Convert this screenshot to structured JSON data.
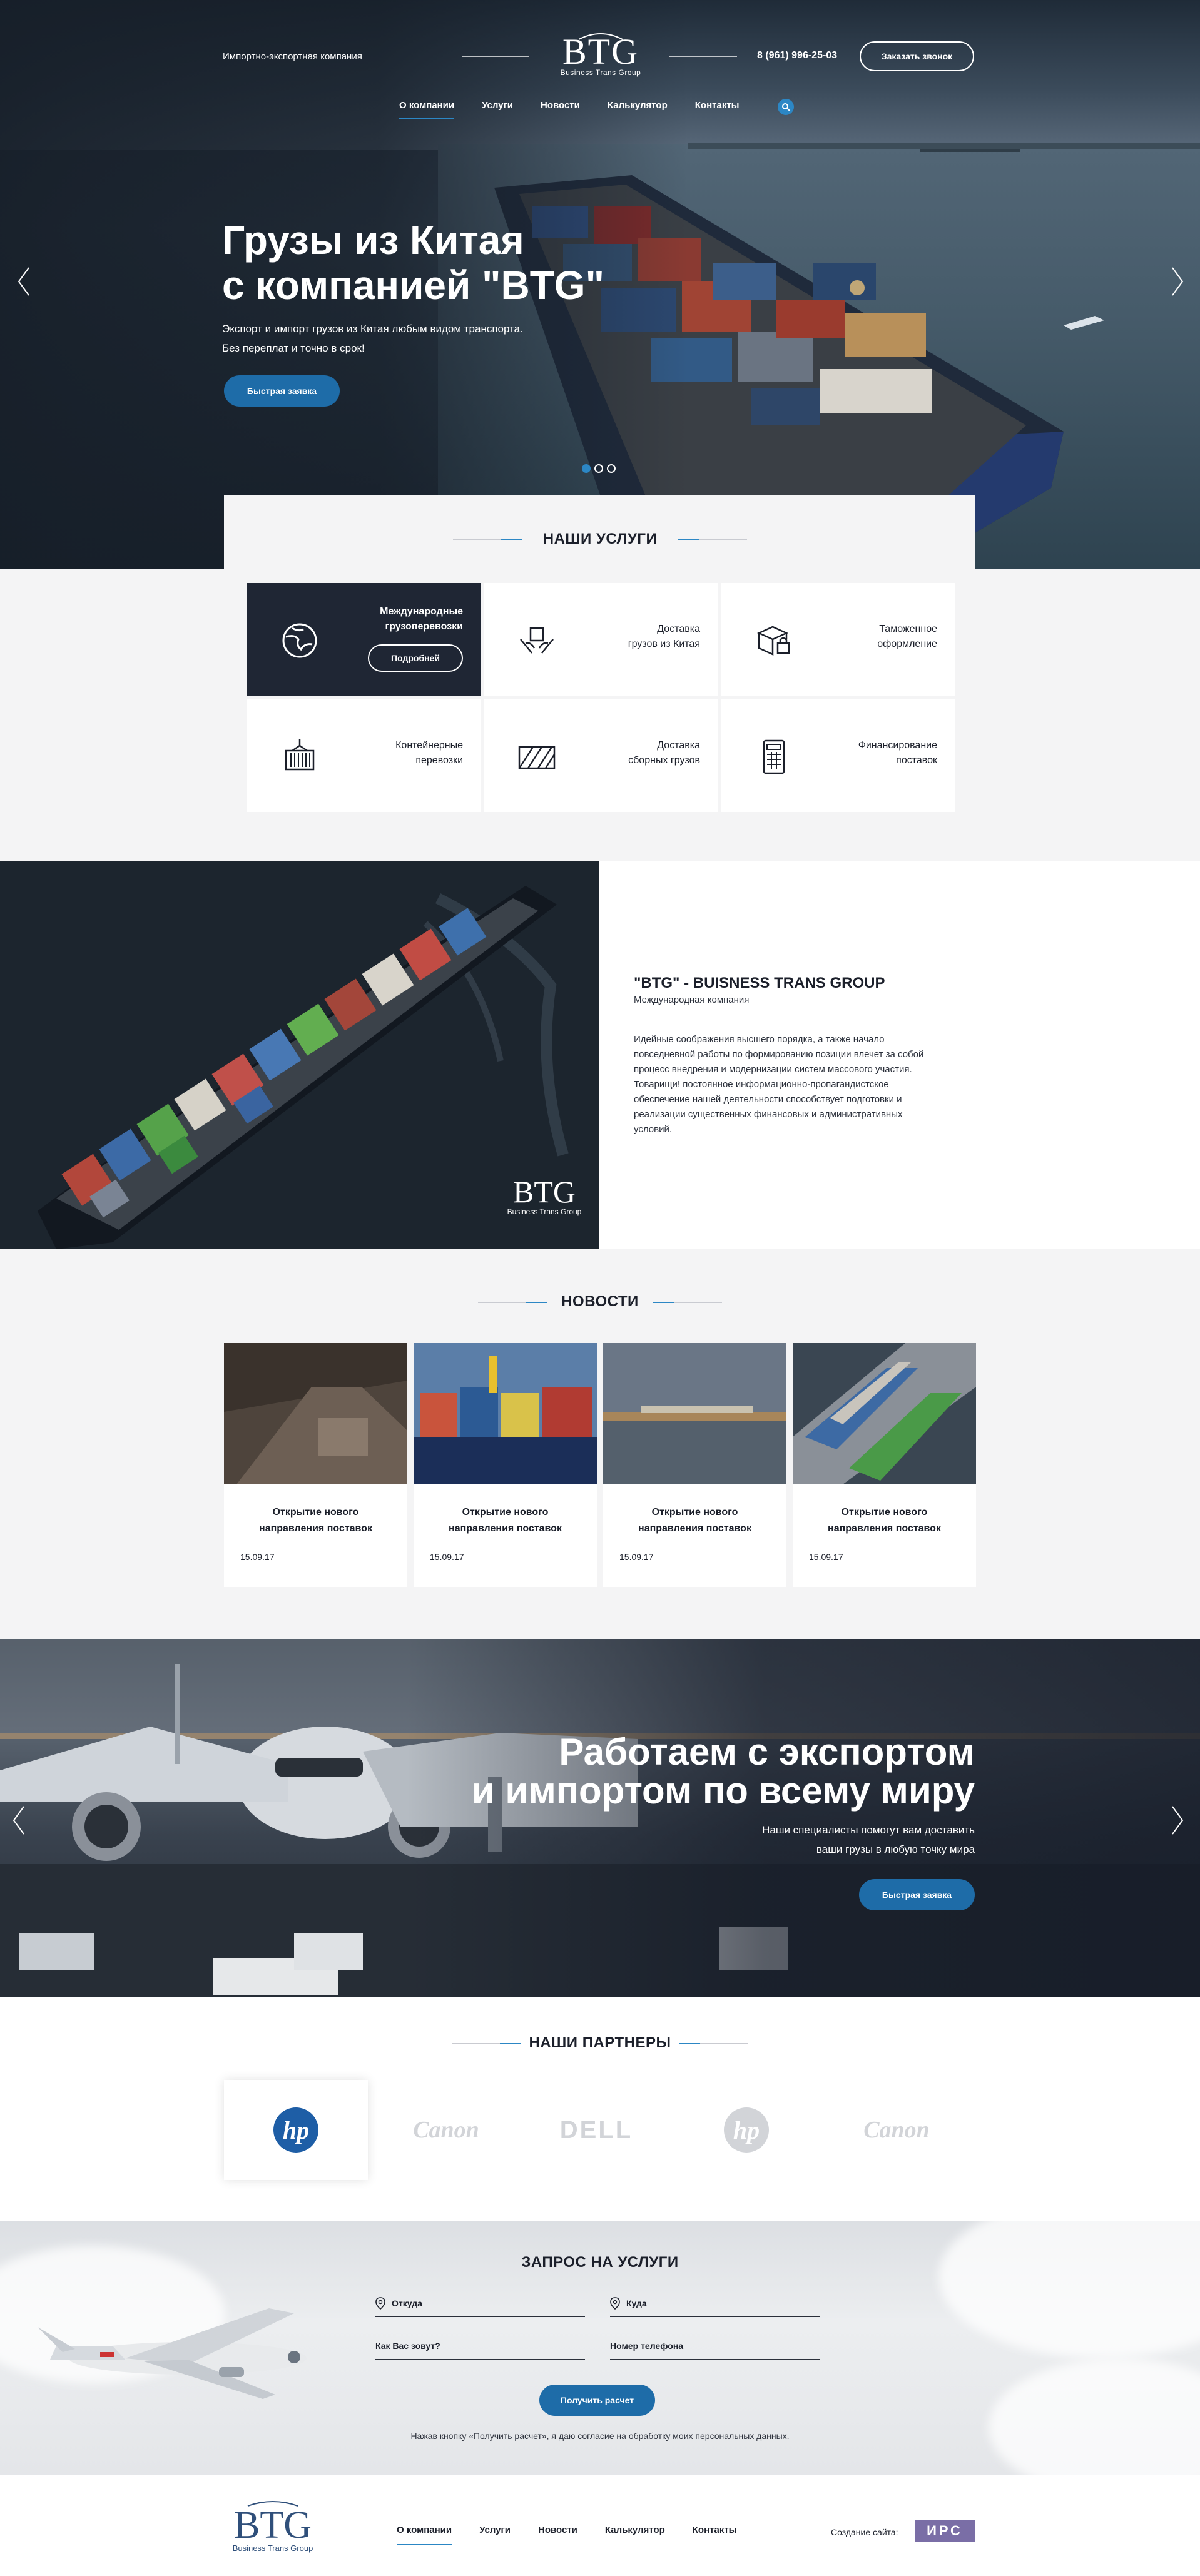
{
  "header": {
    "tagline": "Импортно-экспортная компания",
    "logo_mark": "BTG",
    "logo_sub": "Business Trans Group",
    "phone": "8 (961) 996-25-03",
    "call_button": "Заказать звонок",
    "nav": [
      "О компании",
      "Услуги",
      "Новости",
      "Калькулятор",
      "Контакты"
    ]
  },
  "hero": {
    "title_line1": "Грузы из Китая",
    "title_line2": "с компанией \"BTG\"",
    "text_line1": "Экспорт и импорт грузов из Китая любым видом транспорта.",
    "text_line2": "Без переплат и точно в срок!",
    "button": "Быстрая заявка"
  },
  "services": {
    "title": "НАШИ УСЛУГИ",
    "items": [
      {
        "line1": "Международные",
        "line2": "грузоперевозки",
        "icon": "globe-icon",
        "more": "Подробней"
      },
      {
        "line1": "Доставка",
        "line2": "грузов из Китая",
        "icon": "hands-box-icon"
      },
      {
        "line1": "Таможенное",
        "line2": "оформление",
        "icon": "package-lock-icon"
      },
      {
        "line1": "Контейнерные",
        "line2": "перевозки",
        "icon": "container-icon"
      },
      {
        "line1": "Доставка",
        "line2": "сборных грузов",
        "icon": "pallet-icon"
      },
      {
        "line1": "Финансирование",
        "line2": "поставок",
        "icon": "calculator-icon"
      }
    ]
  },
  "about": {
    "title": "\"BTG\" - BUISNESS TRANS GROUP",
    "subtitle": "Международная компания",
    "text": "Идейные соображения высшего порядка, а также начало повседневной работы по формированию позиции влечет за собой процесс внедрения и модернизации систем массового участия. Товарищи! постоянное информационно-пропагандистское обеспечение нашей деятельности способствует подготовки и реализации существенных финансовых и административных условий.",
    "logo_mark": "BTG",
    "logo_sub": "Business Trans Group"
  },
  "news": {
    "title": "НОВОСТИ",
    "items": [
      {
        "line1": "Открытие нового",
        "line2": "направления поставок",
        "date": "15.09.17"
      },
      {
        "line1": "Открытие нового",
        "line2": "направления поставок",
        "date": "15.09.17"
      },
      {
        "line1": "Открытие нового",
        "line2": "направления поставок",
        "date": "15.09.17"
      },
      {
        "line1": "Открытие нового",
        "line2": "направления поставок",
        "date": "15.09.17"
      }
    ]
  },
  "banner": {
    "title_line1": "Работаем с экспортом",
    "title_line2": "и импортом по всему миру",
    "text_line1": "Наши специалисты помогут вам доставить",
    "text_line2": "ваши грузы в любую точку мира",
    "button": "Быстрая заявка"
  },
  "partners": {
    "title": "НАШИ ПАРТНЕРЫ",
    "items": [
      "hp",
      "Canon",
      "DELL",
      "hp",
      "Canon"
    ]
  },
  "request": {
    "title": "ЗАПРОС НА УСЛУГИ",
    "from": "Откуда",
    "to": "Куда",
    "name": "Как Вас зовут?",
    "phone": "Номер телефона",
    "button": "Получить расчет",
    "note": "Нажав кнопку «Получить расчет», я даю согласие на обработку моих персональных данных."
  },
  "footer": {
    "logo_mark": "BTG",
    "logo_sub": "Business Trans Group",
    "nav": [
      "О компании",
      "Услуги",
      "Новости",
      "Калькулятор",
      "Контакты"
    ],
    "credit": "Создание сайта:",
    "credit_logo": "ИРС"
  },
  "colors": {
    "accent": "#2c87c5",
    "button": "#1e6ca8",
    "dark": "#1f2634",
    "light_bg": "#f4f4f5"
  }
}
